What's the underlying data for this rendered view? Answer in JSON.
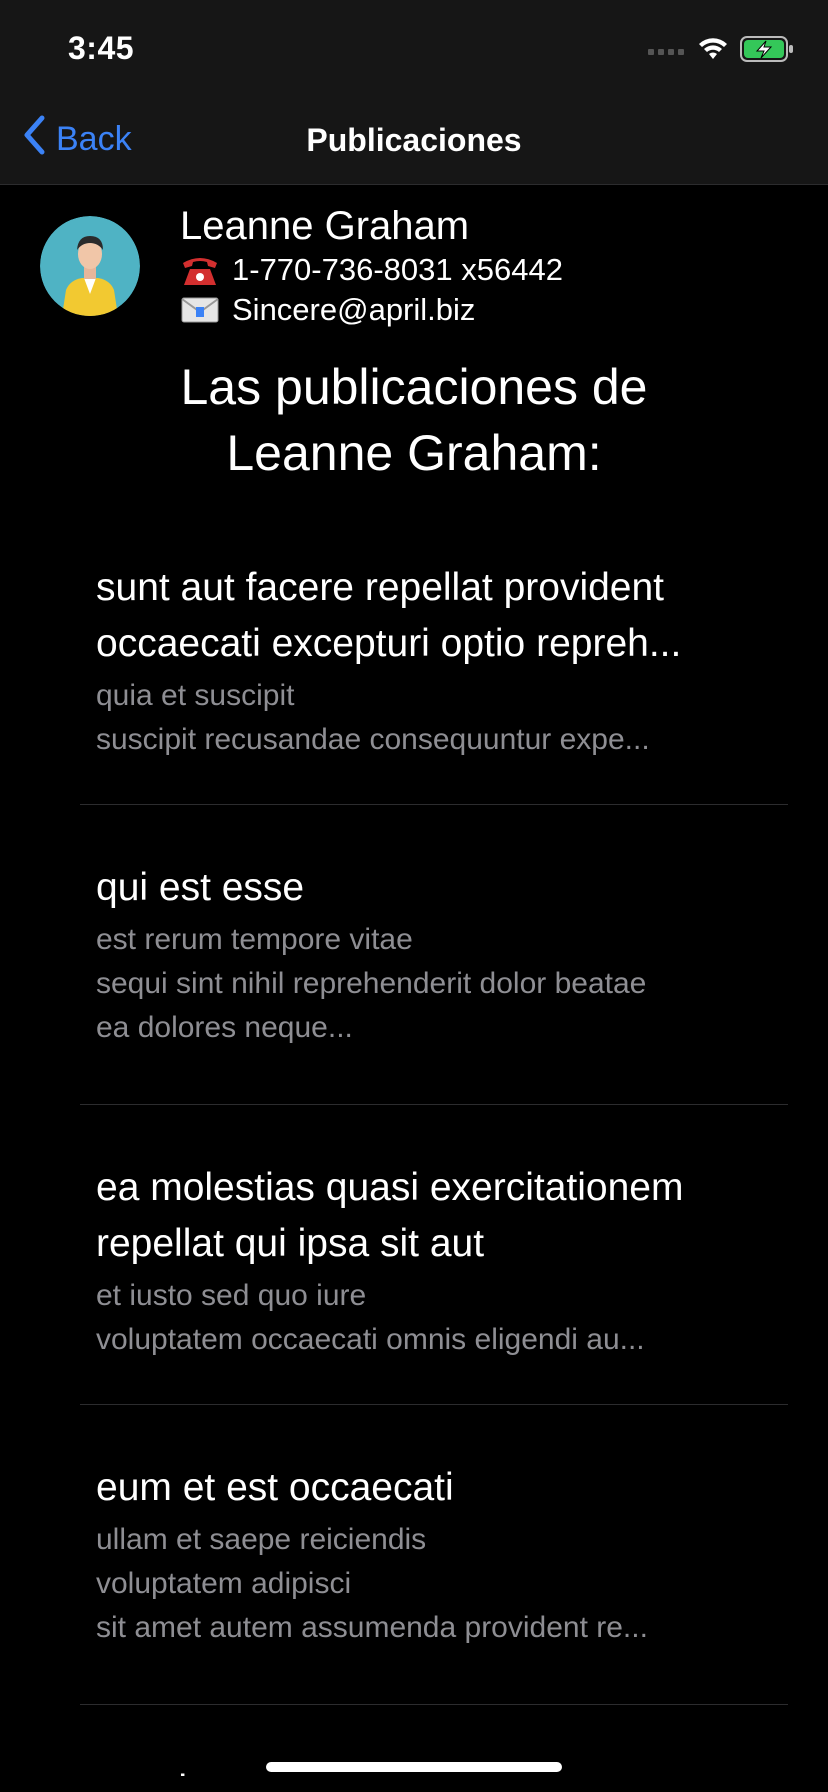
{
  "status_bar": {
    "time": "3:45",
    "icons": [
      "signal-icon",
      "wifi-icon",
      "battery-charging-icon"
    ]
  },
  "nav": {
    "back_label": "Back",
    "title": "Publicaciones",
    "accent_color": "#3b82f6"
  },
  "user": {
    "name": "Leanne Graham",
    "phone_icon": "telephone-icon",
    "phone": "1-770-736-8031 x56442",
    "email_icon": "envelope-icon",
    "email": "Sincere@april.biz"
  },
  "section_title": "Las publicaciones de\nLeanne Graham:",
  "posts": [
    {
      "title": "sunt aut facere repellat provident\noccaecati excepturi optio repreh...",
      "body": "quia et suscipit\nsuscipit recusandae consequuntur expe..."
    },
    {
      "title": "qui est esse",
      "body": "est rerum tempore vitae\nsequi sint nihil reprehenderit dolor beatae\nea dolores neque..."
    },
    {
      "title": "ea molestias quasi exercitationem\nrepellat qui ipsa sit aut",
      "body": "et iusto sed quo iure\nvoluptatem occaecati omnis eligendi au..."
    },
    {
      "title": "eum et est occaecati",
      "body": "ullam et saepe reiciendis\nvoluptatem adipisci\nsit amet autem assumenda provident re..."
    }
  ],
  "partial_next_post": "nesciunt quas odio"
}
